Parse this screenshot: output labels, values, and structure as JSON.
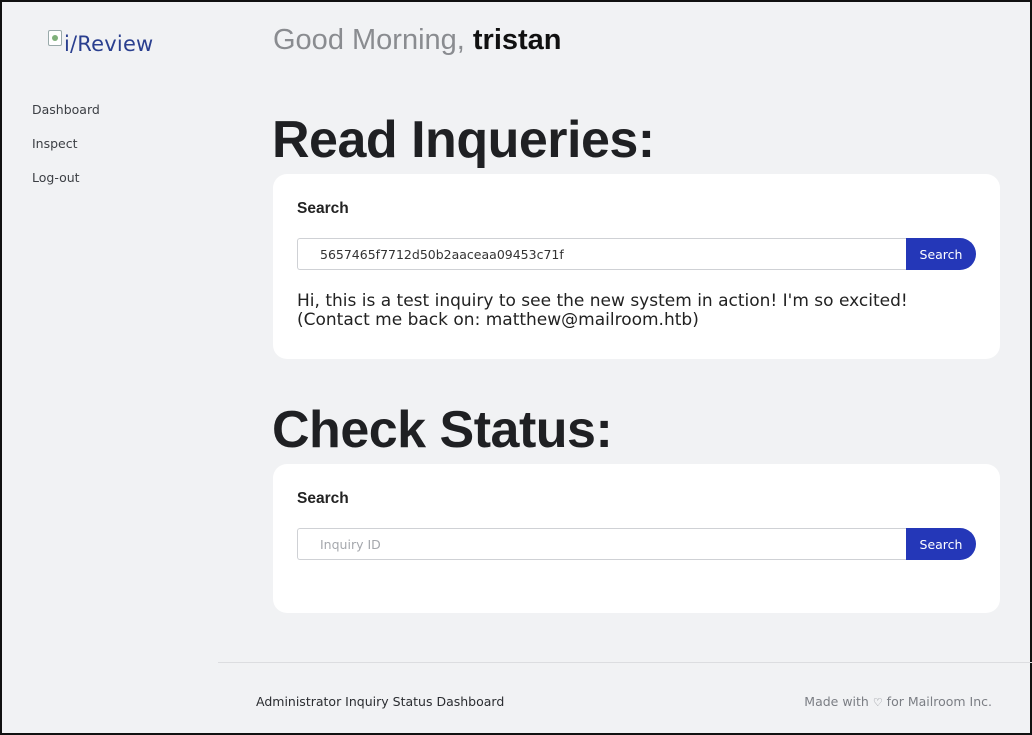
{
  "logo": {
    "text": "i/Review"
  },
  "sidebar": {
    "items": [
      {
        "label": "Dashboard"
      },
      {
        "label": "Inspect"
      },
      {
        "label": "Log-out"
      }
    ]
  },
  "greeting": {
    "prefix": "Good Morning, ",
    "user": "tristan"
  },
  "read_section": {
    "title": "Read Inqueries:",
    "label": "Search",
    "input_value": "5657465f7712d50b2aaceaa09453c71f",
    "button_label": "Search",
    "result": "Hi, this is a test inquiry to see the new system in action! I'm so excited! (Contact me back on: matthew@mailroom.htb)"
  },
  "status_section": {
    "title": "Check Status:",
    "label": "Search",
    "placeholder": "Inquiry ID",
    "button_label": "Search"
  },
  "footer": {
    "left": "Administrator Inquiry Status Dashboard",
    "right_prefix": "Made with ",
    "heart": "♡",
    "right_suffix": " for Mailroom Inc."
  },
  "colors": {
    "accent": "#2437b8",
    "background": "#f1f2f4",
    "logo": "#2a3f8f"
  }
}
